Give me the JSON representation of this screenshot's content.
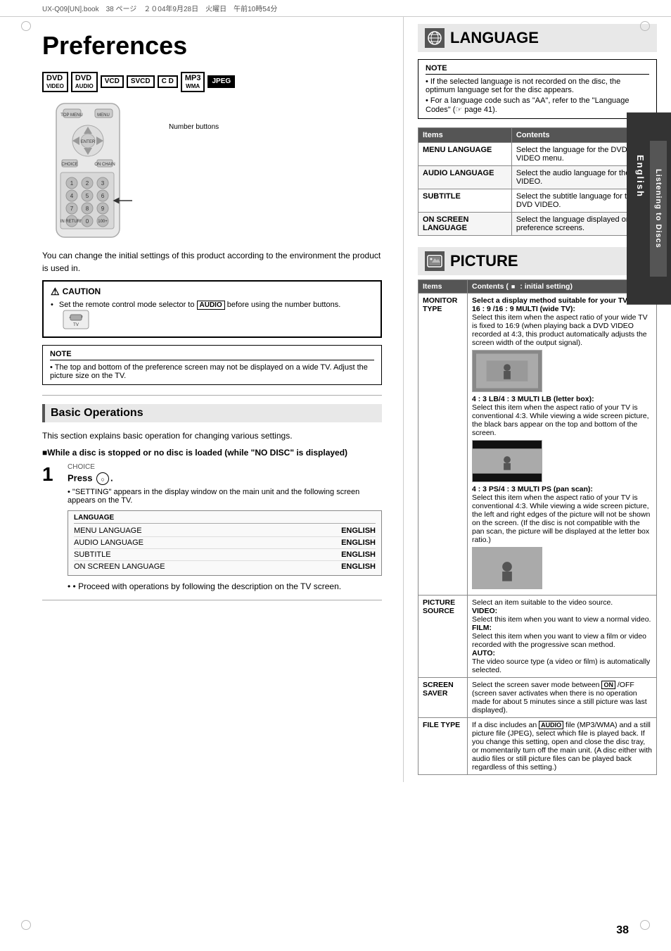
{
  "page": {
    "title": "Preferences",
    "number": "38",
    "topbar": "UX-Q09[UN].book　38 ページ　２０04年9月28日　火曜日　午前10時54分"
  },
  "sidebar_label": "Listening to Discs",
  "sidebar_lang": "English",
  "format_badges": [
    {
      "label": "DVD",
      "sub": "VIDEO",
      "highlight": false
    },
    {
      "label": "DVD",
      "sub": "AUDIO",
      "highlight": false
    },
    {
      "label": "VCD",
      "sub": "",
      "highlight": false
    },
    {
      "label": "SVCD",
      "sub": "",
      "highlight": false
    },
    {
      "label": "C D",
      "sub": "",
      "highlight": false
    },
    {
      "label": "MP3",
      "sub": "WMA",
      "highlight": false
    },
    {
      "label": "JPEG",
      "sub": "",
      "highlight": false
    }
  ],
  "remote_label": "Number buttons",
  "intro_text": "You can change the initial settings of this product according to the environment the product is used in.",
  "caution": {
    "title": "CAUTION",
    "text": "Set the remote control mode selector to AUDIO before using the number buttons.",
    "audio_badge": "AUDIO",
    "tv_badge": "TV"
  },
  "note_left": {
    "title": "NOTE",
    "text": "The top and bottom of the preference screen may not be displayed on a wide TV. Adjust the picture size on the TV."
  },
  "basic_ops": {
    "title": "Basic Operations",
    "intro": "This section explains basic operation for changing various settings.",
    "bold_intro": "■While a disc is stopped or no disc is loaded (while \"NO DISC\" is displayed)",
    "step1": {
      "number": "1",
      "label": "CHOICE",
      "press_text": "Press",
      "description": "\"SETTING\" appears in the display window on the main unit and the following screen appears on the TV.",
      "screen_rows": [
        {
          "label": "LANGUAGE",
          "value": ""
        },
        {
          "label": "MENU LANGUAGE",
          "value": "ENGLISH"
        },
        {
          "label": "AUDIO LANGUAGE",
          "value": "ENGLISH"
        },
        {
          "label": "SUBTITLE",
          "value": "ENGLISH"
        },
        {
          "label": "ON SCREEN LANGUAGE",
          "value": "ENGLISH"
        }
      ]
    },
    "proceed_text": "• Proceed with operations by following the description on the TV screen."
  },
  "language_section": {
    "title": "LANGUAGE",
    "icon": "🌐",
    "note": {
      "title": "NOTE",
      "items": [
        "If the selected language is not recorded on the disc, the optimum language set for the disc appears.",
        "For a language code such as \"AA\", refer to the \"Language Codes\" (☞ page 41)."
      ]
    },
    "table": {
      "headers": [
        "Items",
        "Contents"
      ],
      "rows": [
        {
          "item": "MENU LANGUAGE",
          "content": "Select the language for the DVD VIDEO menu."
        },
        {
          "item": "AUDIO LANGUAGE",
          "content": "Select the audio language for the DVD VIDEO."
        },
        {
          "item": "SUBTITLE",
          "content": "Select the subtitle language for the DVD VIDEO."
        },
        {
          "item": "ON SCREEN LANGUAGE",
          "content": "Select the language displayed on the preference screens."
        }
      ]
    }
  },
  "picture_section": {
    "title": "PICTURE",
    "table": {
      "headers": [
        "Items",
        "Contents (■: initial setting)"
      ],
      "rows": [
        {
          "item": "MONITOR TYPE",
          "content_title": "Select a display method suitable for your TV.",
          "content_body": "16 : 9 /16 : 9 MULTI (wide TV):\nSelect this item when the aspect ratio of your wide TV is fixed to 16:9 (when playing back a DVD VIDEO recorded at 4:3, this product automatically adjusts the screen width of the output signal).\n\n4 : 3 LB/4 : 3 MULTI LB (letter box):\nSelect this item when the aspect ratio of your TV is conventional 4:3. While viewing a wide screen picture, the black bars appear on the top and bottom of the screen.\n\n4 : 3 PS/4 : 3 MULTI PS (pan scan):\nSelect this item when the aspect ratio of your TV is conventional 4:3. While viewing a wide screen picture, the left and right edges of the picture will not be shown on the screen. (If the disc is not compatible with the pan scan, the picture will be displayed at the letter box ratio.)",
          "has_thumbnails": true
        },
        {
          "item": "PICTURE SOURCE",
          "content_body": "Select an item suitable to the video source.\nVIDEO:\nSelect this item when you want to view a normal video.\nFILM:\nSelect this item when you want to view a film or video recorded with the progressive scan method.\nAUTO:\nThe video source type (a video or film) is automatically selected.",
          "has_thumbnails": false
        },
        {
          "item": "SCREEN SAVER",
          "content_body": "Select the screen saver mode between ON /OFF (screen saver activates when there is no operation made for about 5 minutes since a still picture was last displayed).",
          "has_thumbnails": false
        },
        {
          "item": "FILE TYPE",
          "content_body": "If a disc includes an AUDIO file (MP3/WMA) and a still picture file (JPEG), select which file is played back. If you change this setting, open and close the disc tray, or momentarily turn off the main unit. (A disc either with audio files or still picture files can be played back regardless of this setting.)",
          "has_thumbnails": false
        }
      ]
    }
  }
}
